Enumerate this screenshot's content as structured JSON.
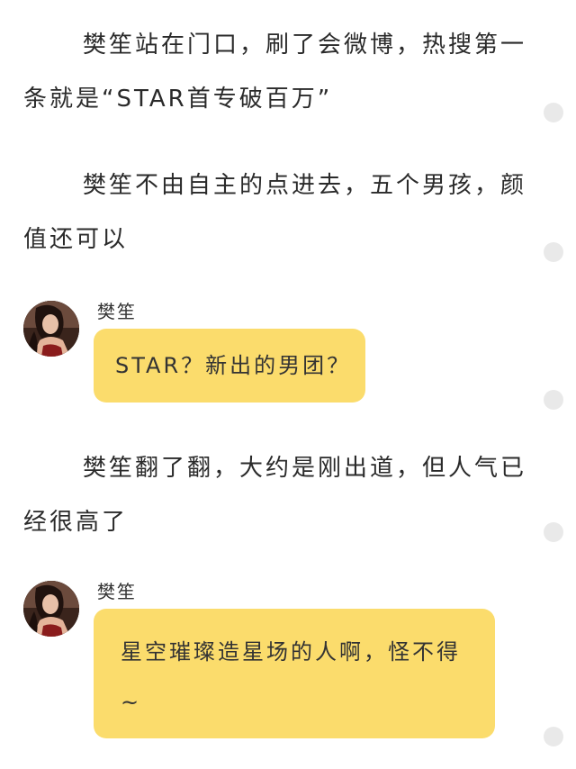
{
  "story": {
    "paragraph_1": "樊笙站在门口，刷了会微博，热搜第一条就是“STAR首专破百万”",
    "paragraph_2": "樊笙不由自主的点进去，五个男孩，颜值还可以",
    "paragraph_3": "樊笙翻了翻，大约是刚出道，但人气已经很高了"
  },
  "messages": [
    {
      "sender": "樊笙",
      "text": "STAR？新出的男团？"
    },
    {
      "sender": "樊笙",
      "text": "星空璀璨造星场的人啊，怪不得~"
    }
  ],
  "colors": {
    "bubble": "#fbdc6c",
    "text": "#2a2a2a",
    "side_dot": "#e9e9e9",
    "background": "#ffffff"
  }
}
